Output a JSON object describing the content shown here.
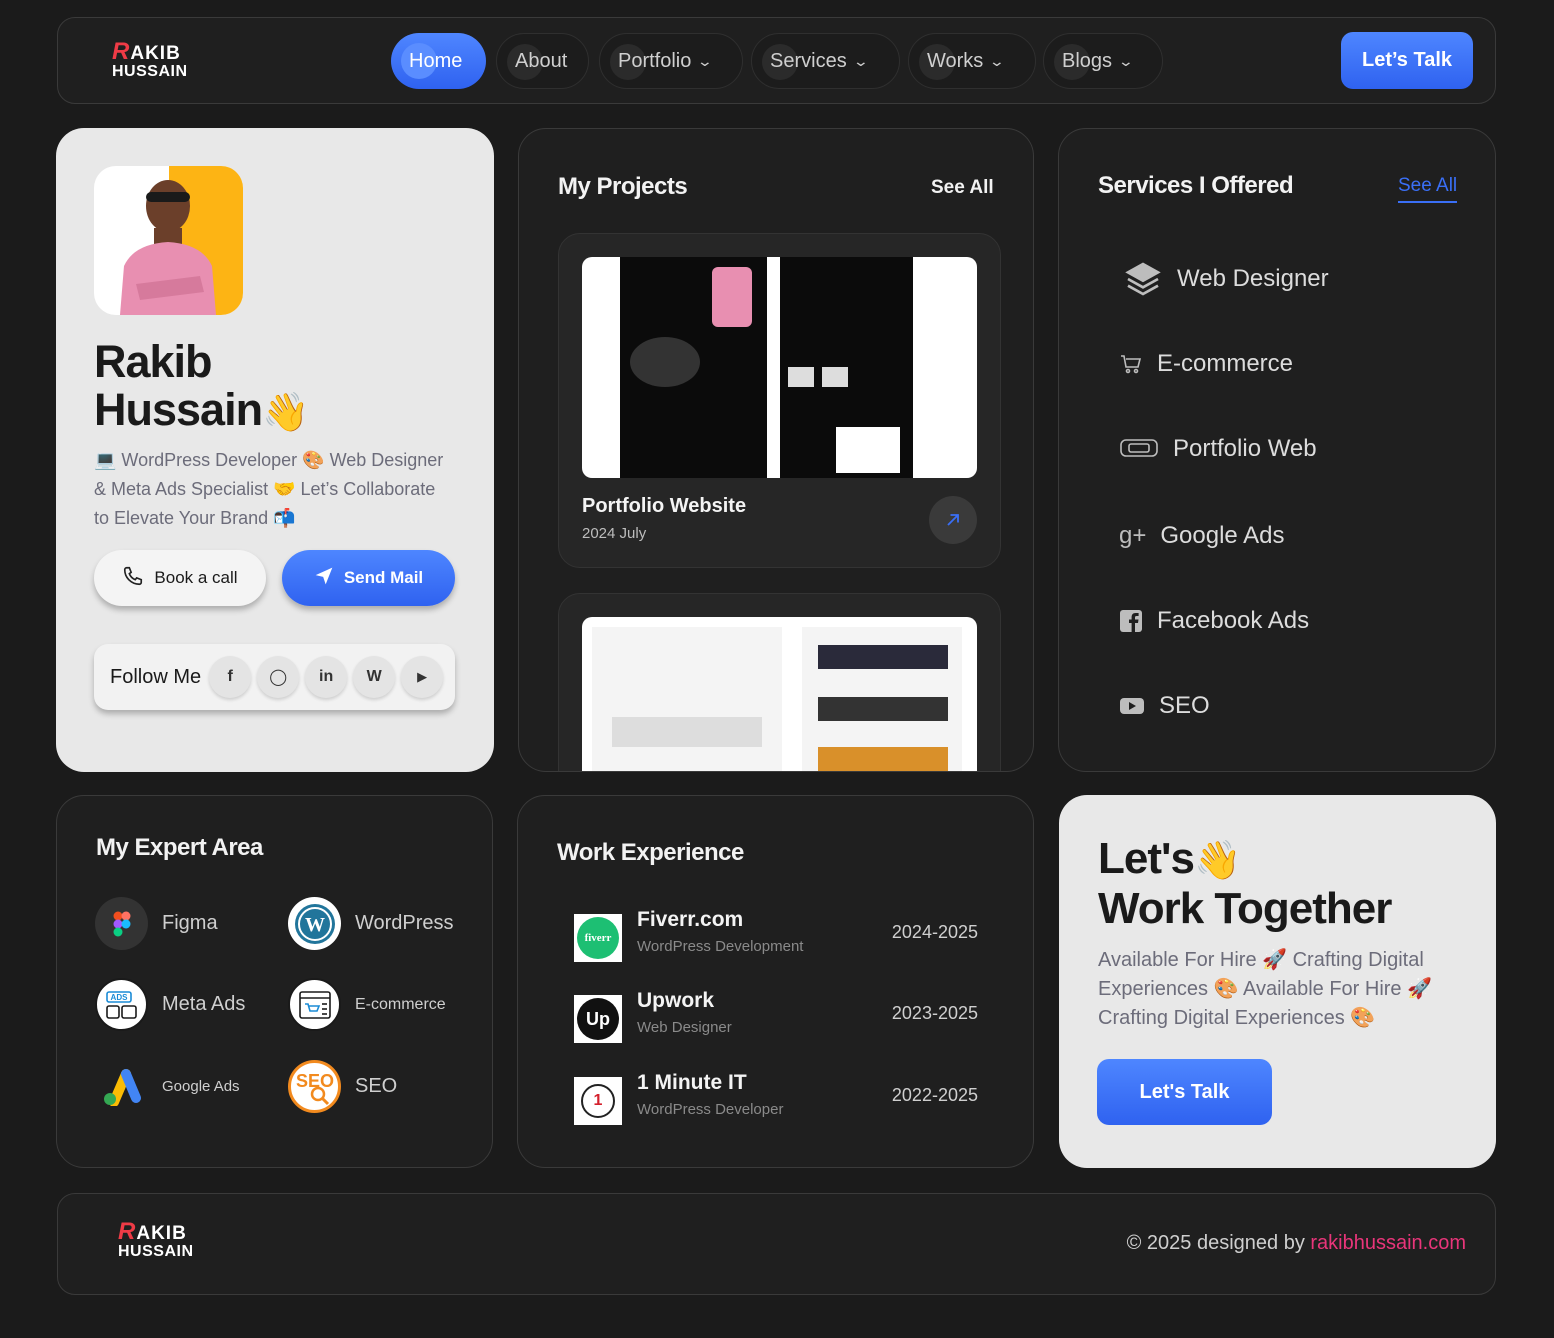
{
  "logo": {
    "line1_initial": "R",
    "line1_rest": "AKIB",
    "line2": "HUSSAIN"
  },
  "nav": {
    "items": [
      {
        "label": "Home",
        "chevron": false
      },
      {
        "label": "About",
        "chevron": false
      },
      {
        "label": "Portfolio",
        "chevron": true
      },
      {
        "label": "Services",
        "chevron": true
      },
      {
        "label": "Works",
        "chevron": true
      },
      {
        "label": "Blogs",
        "chevron": true
      }
    ],
    "chevron_glyph": "⌄",
    "cta_label": "Let’s Talk"
  },
  "profile": {
    "first_name": "Rakib",
    "last_name": "Hussain",
    "wave": "👋",
    "bio": "💻 WordPress Developer 🎨 Web Designer & Meta Ads Specialist 🤝 Let’s Collaborate to Elevate Your Brand 📬",
    "book_call_label": "Book a call",
    "send_mail_label": "Send Mail",
    "follow_label": "Follow Me",
    "socials": [
      {
        "name": "facebook-icon",
        "glyph": "f"
      },
      {
        "name": "whatsapp-icon",
        "glyph": "◯"
      },
      {
        "name": "linkedin-icon",
        "glyph": "in"
      },
      {
        "name": "wordpress-icon",
        "glyph": "W"
      },
      {
        "name": "youtube-icon",
        "glyph": "▶"
      }
    ]
  },
  "projects": {
    "title": "My Projects",
    "see_all": "See All",
    "items": [
      {
        "title": "Portfolio Website",
        "date": "2024 July"
      }
    ]
  },
  "services": {
    "title": "Services I Offered",
    "see_all": "See All",
    "items": [
      {
        "label": "Web Designer",
        "icon": "layers-icon"
      },
      {
        "label": "E-commerce",
        "icon": "cart-icon"
      },
      {
        "label": "Portfolio Web",
        "icon": "vr-headset-icon"
      },
      {
        "label": "Google Ads",
        "icon": "google-plus-icon"
      },
      {
        "label": "Facebook Ads",
        "icon": "facebook-icon"
      },
      {
        "label": "SEO",
        "icon": "youtube-icon"
      }
    ]
  },
  "expert": {
    "title": "My Expert Area",
    "items": [
      {
        "label": "Figma",
        "icon": "figma-icon"
      },
      {
        "label": "WordPress",
        "icon": "wordpress-icon"
      },
      {
        "label": "Meta Ads",
        "icon": "ads-icon"
      },
      {
        "label": "E-commerce",
        "icon": "ecommerce-icon"
      },
      {
        "label": "Google Ads",
        "icon": "google-ads-icon"
      },
      {
        "label": "SEO",
        "icon": "seo-icon"
      }
    ]
  },
  "work": {
    "title": "Work Experience",
    "jobs": [
      {
        "company": "Fiverr.com",
        "role": "WordPress Development",
        "years": "2024-2025",
        "logo_text": "fiverr"
      },
      {
        "company": "Upwork",
        "role": "Web Designer",
        "years": "2023-2025",
        "logo_text": "Up"
      },
      {
        "company": "1 Minute IT",
        "role": "WordPress Developer",
        "years": "2022-2025",
        "logo_text": "1"
      }
    ]
  },
  "cta": {
    "line1": "Let's",
    "wave": "👋",
    "line2": "Work Together",
    "text": "Available For Hire 🚀 Crafting Digital Experiences 🎨 Available For Hire 🚀 Crafting Digital Experiences 🎨",
    "button": "Let's Talk"
  },
  "footer": {
    "copyright": "© 2025 designed by",
    "link": "rakibhussain.com"
  },
  "colors": {
    "accent_blue": "#3a6ff6",
    "link_pink": "#e9357a",
    "logo_red": "#ef3b46",
    "avatar_yellow": "#fdb414"
  }
}
